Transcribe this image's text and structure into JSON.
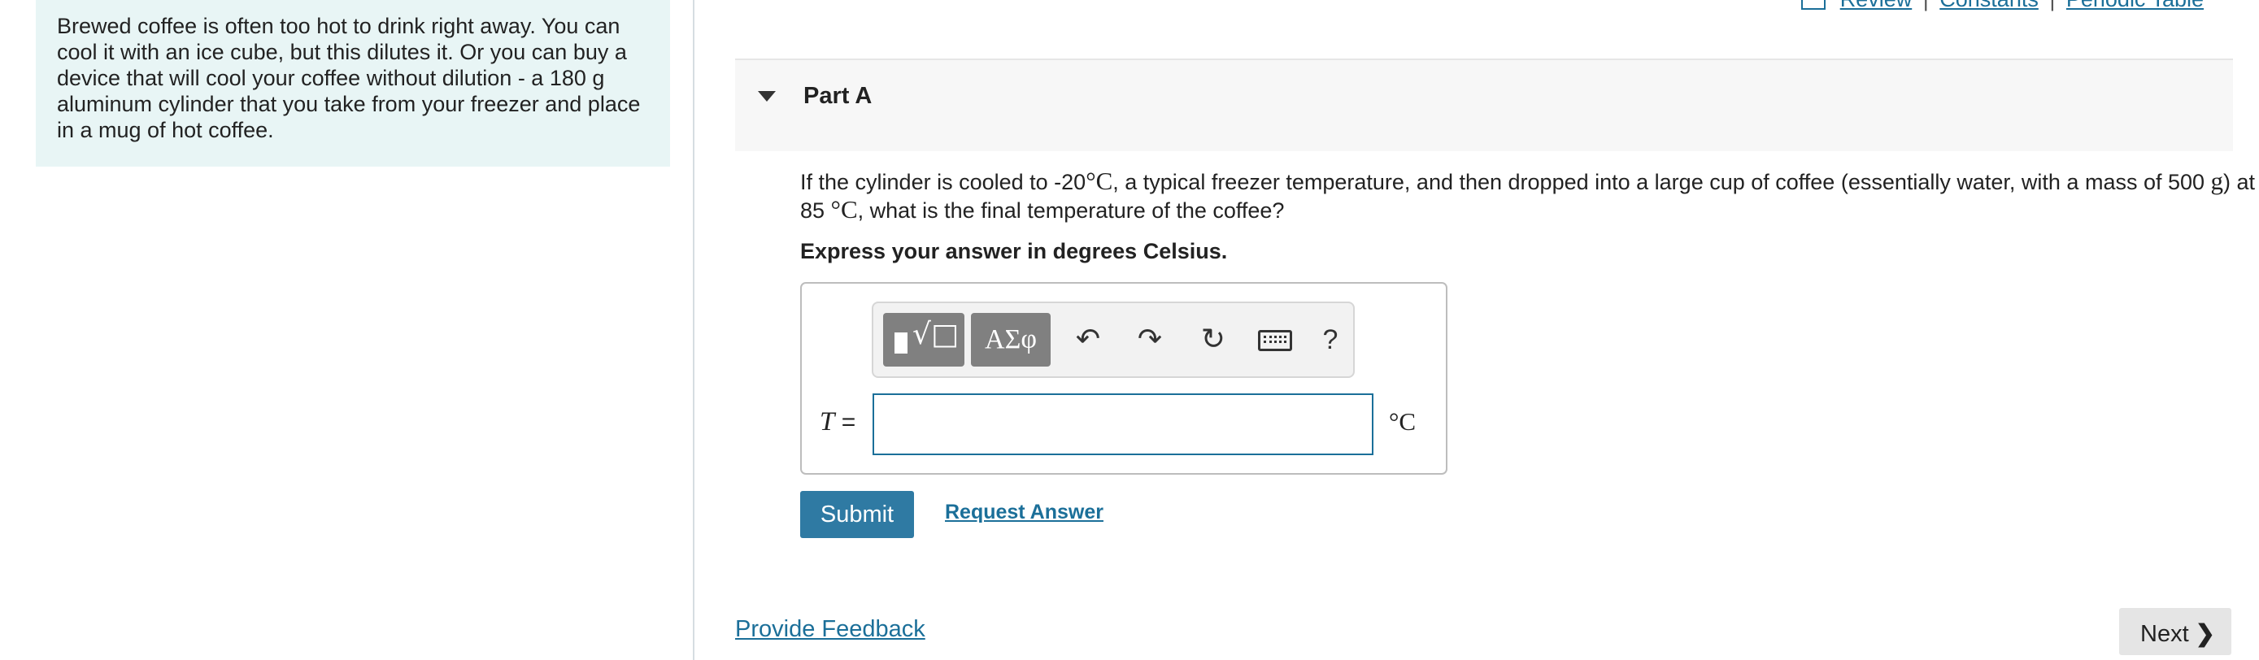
{
  "intro": {
    "text": "Brewed coffee is often too hot to drink right away. You can cool it with an ice cube, but this dilutes it. Or you can buy a device that will cool your coffee without dilution - a 180  g aluminum cylinder that you take from your freezer and place in a mug of hot coffee."
  },
  "top_links": {
    "review": "Review",
    "constants": "Constants",
    "periodic_table": "Periodic Table",
    "separator": "|"
  },
  "part": {
    "title": "Part A"
  },
  "question": {
    "part1": "If the cylinder is cooled to -20",
    "unit1": "°C",
    "part2": ", a typical freezer temperature, and then dropped into a large cup of coffee (essentially water, with a mass of 500 ",
    "unit_g": "g",
    "part3": ") at 85 ",
    "unit2": "°C",
    "part4": ", what is the final temperature of the coffee?"
  },
  "instruction": "Express your answer in degrees Celsius.",
  "toolbar": {
    "greek_label": "ΑΣφ",
    "radical_symbol": "√□",
    "help_label": "?",
    "icons": [
      "templates-icon",
      "greek-letters-icon",
      "undo-icon",
      "redo-icon",
      "reset-icon",
      "keyboard-icon",
      "help-icon"
    ]
  },
  "answer": {
    "variable": "T",
    "equals": "=",
    "value": "",
    "unit": "°C"
  },
  "actions": {
    "submit": "Submit",
    "request_answer": "Request Answer",
    "provide_feedback": "Provide Feedback",
    "next": "Next"
  },
  "colors": {
    "accent": "#2f7aa3",
    "link": "#1b6f99",
    "intro_bg": "#e8f5f5"
  }
}
